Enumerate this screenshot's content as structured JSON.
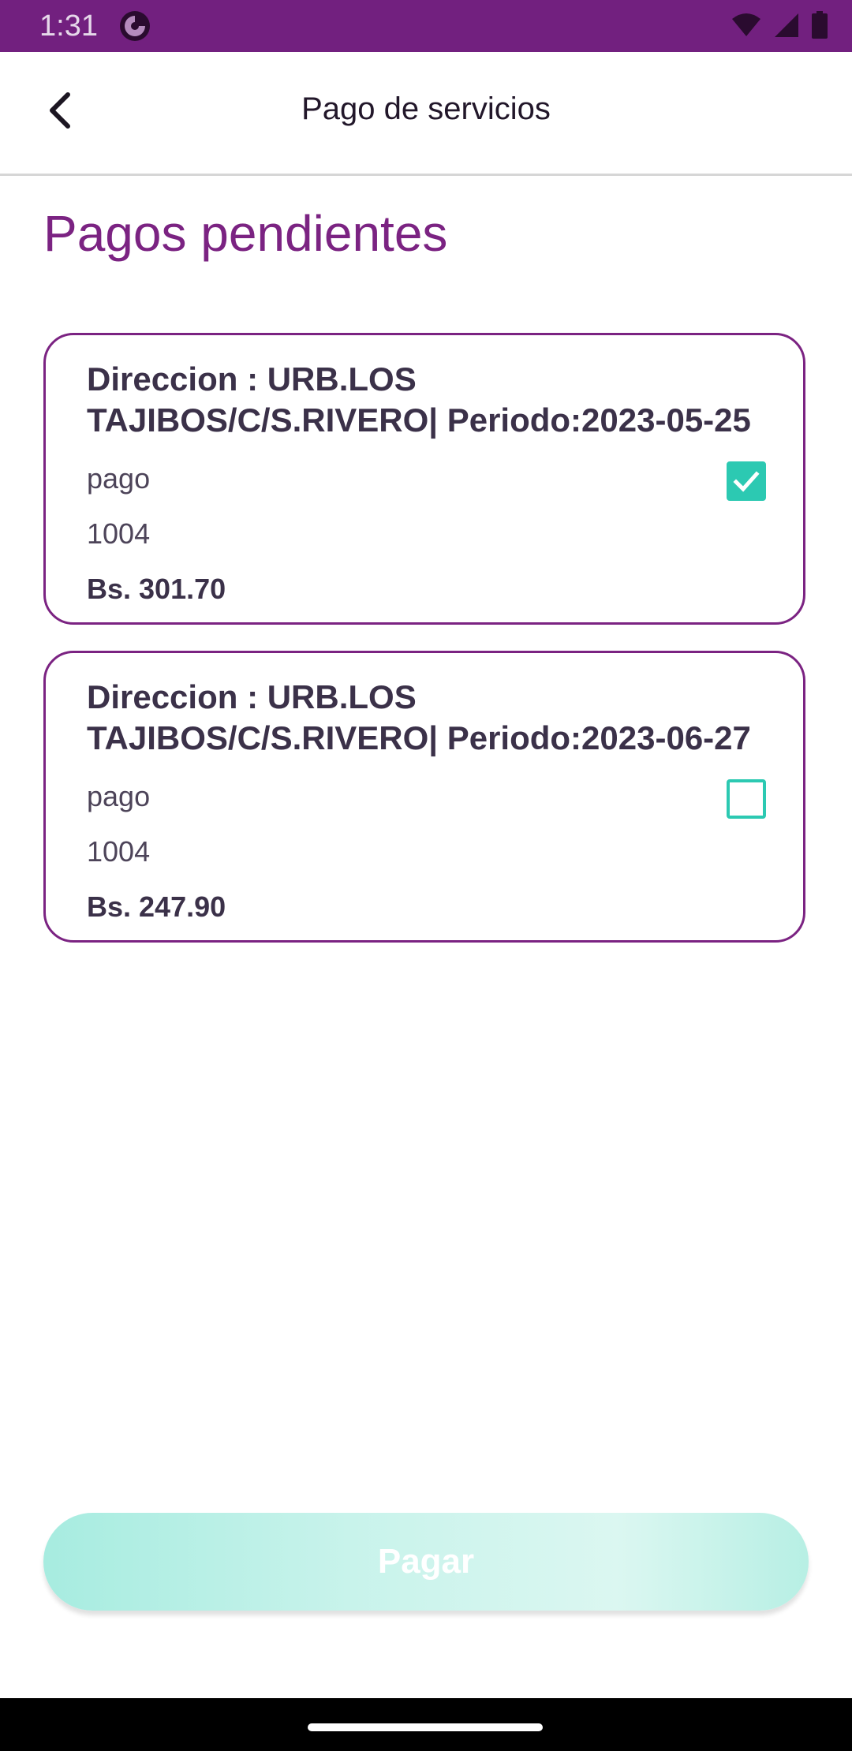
{
  "status_bar": {
    "time": "1:31"
  },
  "header": {
    "title": "Pago de servicios"
  },
  "section": {
    "title": "Pagos pendientes"
  },
  "payments": [
    {
      "address": "Direccion : URB.LOS TAJIBOS/C/S.RIVERO| Periodo:2023-05-25",
      "type": "pago",
      "code": "1004",
      "amount": "Bs. 301.70",
      "checked": true
    },
    {
      "address": "Direccion : URB.LOS TAJIBOS/C/S.RIVERO| Periodo:2023-06-27",
      "type": "pago",
      "code": "1004",
      "amount": "Bs. 247.90",
      "checked": false
    }
  ],
  "actions": {
    "pay_label": "Pagar"
  },
  "colors": {
    "brand_purple": "#72207f",
    "accent_teal": "#2cc9b2",
    "pay_button_bg": "#c8f3eb"
  },
  "icons": {
    "back": "chevron-left-icon",
    "wifi": "wifi-icon",
    "signal": "signal-icon",
    "battery": "battery-icon",
    "checkbox_checked": "check-icon"
  }
}
